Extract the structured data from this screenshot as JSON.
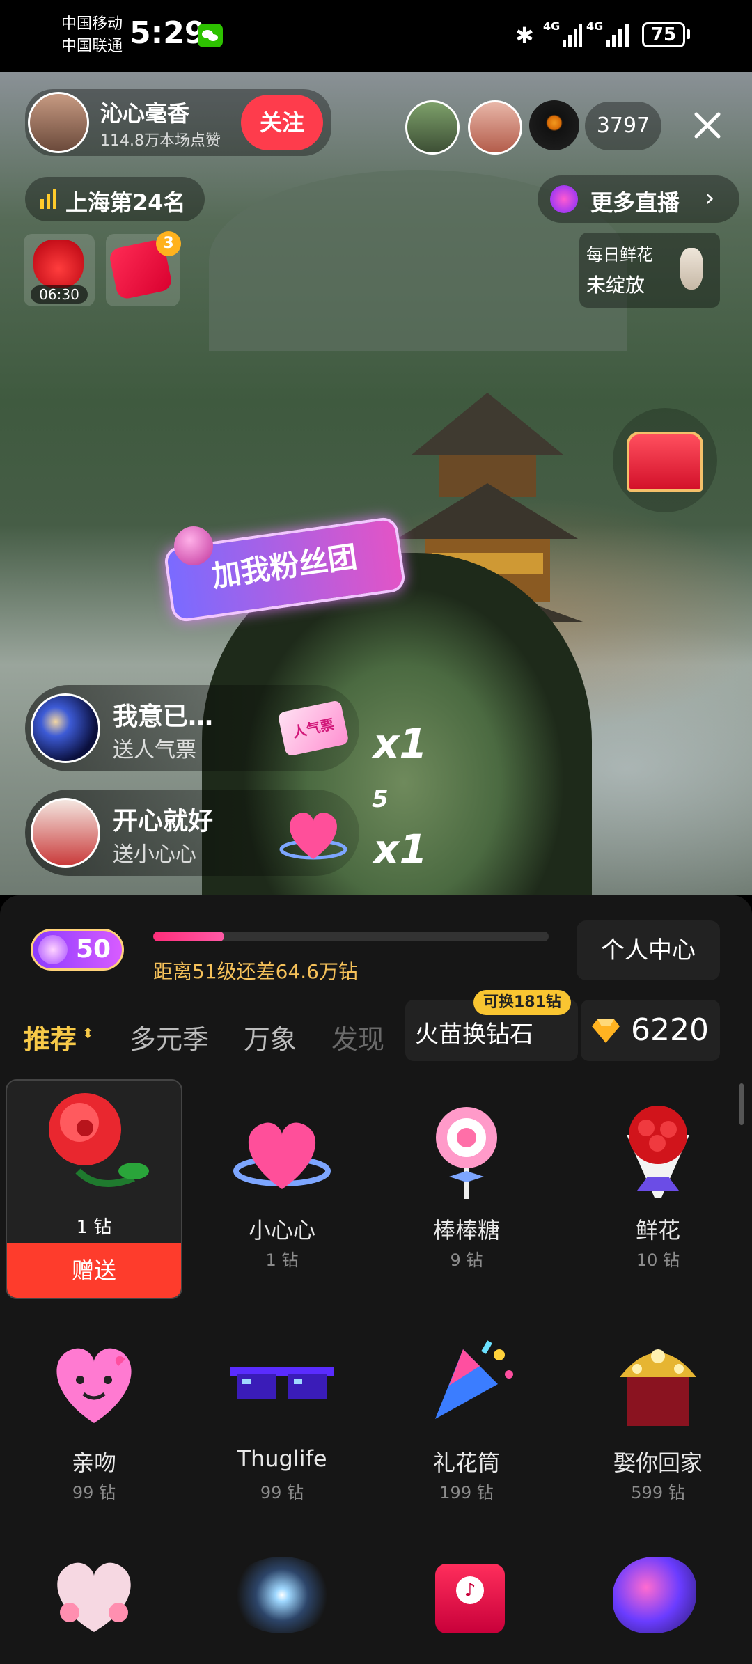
{
  "status_bar": {
    "carrier1": "中国移动",
    "carrier2": "中国联通",
    "time": "5:29",
    "net1": "4G",
    "net2": "4G",
    "battery": "75"
  },
  "host": {
    "name": "沁心毫香",
    "likes": "114.8万本场点赞",
    "follow_label": "关注"
  },
  "viewers": {
    "count": "3797"
  },
  "rank_label": "上海第24名",
  "more_live_label": "更多直播",
  "timer_label": "06:30",
  "red_packet_badge": "3",
  "daily_flower": {
    "line1": "每日鲜花",
    "line2": "未绽放"
  },
  "fan_club_label": "加我粉丝团",
  "gift_feed": [
    {
      "user": "我意已…",
      "action": "送人气票",
      "gift_text": "人气票",
      "count": "x1"
    },
    {
      "user": "开心就好",
      "action": "送小心心",
      "count": "x1"
    }
  ],
  "floating_number": "5",
  "panel": {
    "level": "50",
    "level_progress": 0.18,
    "level_text": "距离51级还差64.6万钻",
    "personal_center": "个人中心",
    "tabs": [
      "推荐",
      "多元季",
      "万象",
      "发现"
    ],
    "exchange_badge": "可换181钻",
    "exchange_label": "火苗换钻石",
    "diamonds": "6220",
    "send_label": "赠送"
  },
  "gifts": [
    {
      "name": "",
      "price": "1 钻"
    },
    {
      "name": "小心心",
      "price": "1 钻"
    },
    {
      "name": "棒棒糖",
      "price": "9 钻"
    },
    {
      "name": "鲜花",
      "price": "10 钻"
    },
    {
      "name": "亲吻",
      "price": "99 钻"
    },
    {
      "name": "Thuglife",
      "price": "99 钻"
    },
    {
      "name": "礼花筒",
      "price": "199 钻"
    },
    {
      "name": "娶你回家",
      "price": "599 钻"
    }
  ],
  "icons": {
    "close": "close-icon",
    "bars": "signal-bars-icon",
    "chevron": "chevron-right-icon",
    "bluetooth": "bluetooth-icon",
    "wechat": "wechat-icon"
  }
}
